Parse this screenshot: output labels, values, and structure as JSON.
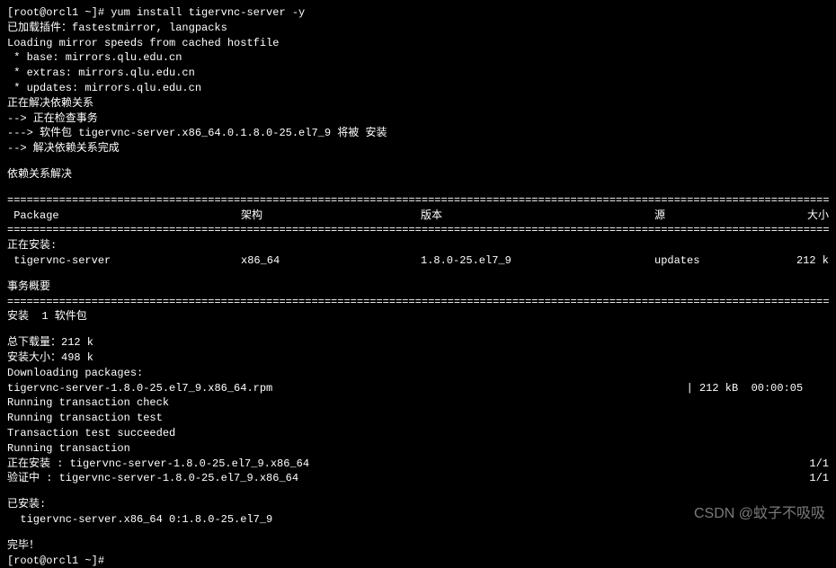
{
  "prompt": "[root@orcl1 ~]# yum install tigervnc-server -y",
  "lines": {
    "plugins": "已加载插件：fastestmirror, langpacks",
    "loading": "Loading mirror speeds from cached hostfile",
    "base": " * base: mirrors.qlu.edu.cn",
    "extras": " * extras: mirrors.qlu.edu.cn",
    "updates": " * updates: mirrors.qlu.edu.cn",
    "resolving": "正在解决依赖关系",
    "check_trans": "--> 正在检查事务",
    "pkg_install": "---> 软件包 tigervnc-server.x86_64.0.1.8.0-25.el7_9 将被 安装",
    "dep_done": "--> 解决依赖关系完成",
    "dep_resolved": "依赖关系解决"
  },
  "header": {
    "package": " Package",
    "arch": "架构",
    "version": "版本",
    "repo": "源",
    "size": "大小"
  },
  "installing_header": "正在安装:",
  "row": {
    "package": " tigervnc-server",
    "arch": "x86_64",
    "version": "1.8.0-25.el7_9",
    "repo": "updates",
    "size": "212 k"
  },
  "summary_header": "事务概要",
  "install_count": "安装  1 软件包",
  "totals": {
    "download": "总下载量：212 k",
    "installed": "安装大小：498 k",
    "downloading": "Downloading packages:",
    "rpm": "tigervnc-server-1.8.0-25.el7_9.x86_64.rpm",
    "rpm_stats": "| 212 kB  00:00:05    "
  },
  "trans": {
    "check": "Running transaction check",
    "test": "Running transaction test",
    "succeeded": "Transaction test succeeded",
    "running": "Running transaction",
    "installing": "  正在安装    : tigervnc-server-1.8.0-25.el7_9.x86_64",
    "verifying": "  验证中      : tigervnc-server-1.8.0-25.el7_9.x86_64",
    "ratio": "1/1"
  },
  "installed_header": "已安装:",
  "installed_pkg": "  tigervnc-server.x86_64 0:1.8.0-25.el7_9",
  "complete": "完毕！",
  "final_prompt": "[root@orcl1 ~]#",
  "watermark": "CSDN @蚊子不吸吸",
  "divider_eq": "=================================================================================================================================",
  "divider_dash": "---------------------------------------------------------------------------------------------------------------------------------"
}
